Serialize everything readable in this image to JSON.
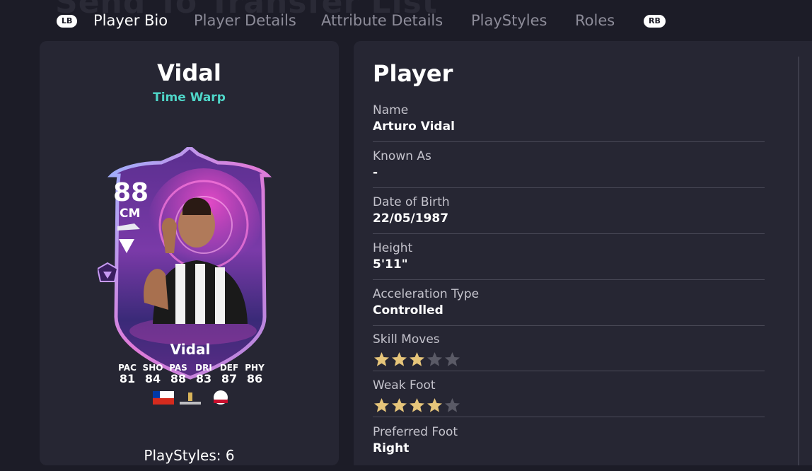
{
  "background_title": "Send To Transfer List",
  "tabs": {
    "left_bumper": "LB",
    "right_bumper": "RB",
    "items": [
      {
        "label": "Player Bio",
        "active": true
      },
      {
        "label": "Player Details",
        "active": false
      },
      {
        "label": "Attribute Details",
        "active": false
      },
      {
        "label": "PlayStyles",
        "active": false
      },
      {
        "label": "Roles",
        "active": false
      }
    ]
  },
  "card": {
    "name": "Vidal",
    "promo": "Time Warp",
    "rating": "88",
    "position": "CM",
    "card_name": "Vidal",
    "stats": [
      {
        "label": "PAC",
        "value": "81"
      },
      {
        "label": "SHO",
        "value": "84"
      },
      {
        "label": "PAS",
        "value": "88"
      },
      {
        "label": "DRI",
        "value": "83"
      },
      {
        "label": "DEF",
        "value": "87"
      },
      {
        "label": "PHY",
        "value": "86"
      }
    ],
    "nation": "Chile",
    "league": "LIBERTADORES",
    "club": "COLO-COLO",
    "accent_color": "#4fd6c8"
  },
  "left_footer": "PlayStyles: 6",
  "player": {
    "title": "Player",
    "fields": [
      {
        "label": "Name",
        "value": "Arturo Vidal"
      },
      {
        "label": "Known As",
        "value": "-"
      },
      {
        "label": "Date of Birth",
        "value": "22/05/1987"
      },
      {
        "label": "Height",
        "value": "5'11\""
      },
      {
        "label": "Acceleration Type",
        "value": "Controlled"
      },
      {
        "label": "Skill Moves",
        "stars": 3,
        "max": 5
      },
      {
        "label": "Weak Foot",
        "stars": 4,
        "max": 5
      },
      {
        "label": "Preferred Foot",
        "value": "Right"
      }
    ]
  },
  "colors": {
    "background": "#1c1c27",
    "panel": "#262633",
    "star_filled": "#e6c57a",
    "star_empty": "#5a5a66"
  }
}
